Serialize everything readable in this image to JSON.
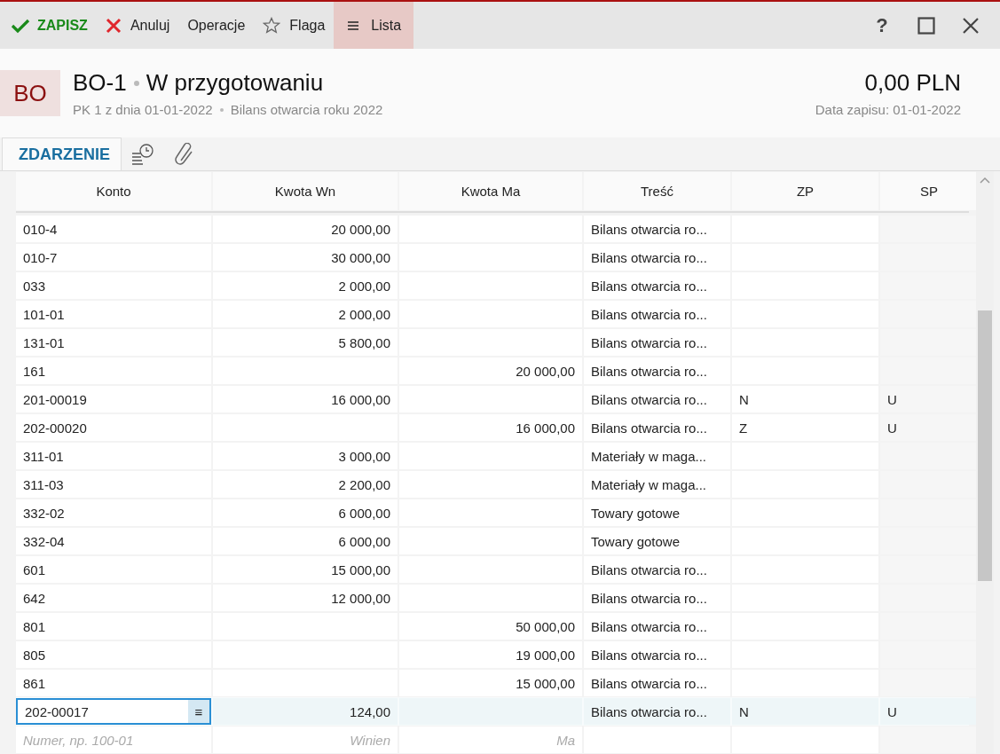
{
  "toolbar": {
    "buttons": [
      {
        "kind": "save",
        "label": "ZAPISZ",
        "selected": false
      },
      {
        "kind": "cancel",
        "label": "Anuluj",
        "selected": false
      },
      {
        "kind": "plain",
        "label": "Operacje",
        "selected": false
      },
      {
        "kind": "flag",
        "label": "Flaga",
        "selected": false
      },
      {
        "kind": "list",
        "label": "Lista",
        "selected": true
      }
    ],
    "help": "?"
  },
  "header": {
    "badge": "BO",
    "number": "BO-1",
    "status": "W przygotowaniu",
    "subtitle": "PK 1 z dnia 01-01-2022",
    "description": "Bilans otwarcia roku 2022",
    "amount": "0,00 PLN",
    "date": "Data zapisu: 01-01-2022"
  },
  "tabs": [
    {
      "kind": "text",
      "label": "ZDARZENIE",
      "selected": true
    },
    {
      "kind": "history",
      "selected": false
    },
    {
      "kind": "attachments",
      "selected": false
    }
  ],
  "table": {
    "columns": [
      "Konto",
      "Kwota Wn",
      "Kwota Ma",
      "Treść",
      "ZP",
      "SP"
    ],
    "rows": [
      {
        "konto": "010-4",
        "wn": "20 000,00",
        "ma": "",
        "tresc": "Bilans otwarcia ro...",
        "zp": "",
        "sp": "",
        "selected": false
      },
      {
        "konto": "010-7",
        "wn": "30 000,00",
        "ma": "",
        "tresc": "Bilans otwarcia ro...",
        "zp": "",
        "sp": "",
        "selected": false
      },
      {
        "konto": "033",
        "wn": "2 000,00",
        "ma": "",
        "tresc": "Bilans otwarcia ro...",
        "zp": "",
        "sp": "",
        "selected": false
      },
      {
        "konto": "101-01",
        "wn": "2 000,00",
        "ma": "",
        "tresc": "Bilans otwarcia ro...",
        "zp": "",
        "sp": "",
        "selected": false
      },
      {
        "konto": "131-01",
        "wn": "5 800,00",
        "ma": "",
        "tresc": "Bilans otwarcia ro...",
        "zp": "",
        "sp": "",
        "selected": false
      },
      {
        "konto": "161",
        "wn": "",
        "ma": "20 000,00",
        "tresc": "Bilans otwarcia ro...",
        "zp": "",
        "sp": "",
        "selected": false
      },
      {
        "konto": "201-00019",
        "wn": "16 000,00",
        "ma": "",
        "tresc": "Bilans otwarcia ro...",
        "zp": "N",
        "sp": "U",
        "selected": false
      },
      {
        "konto": "202-00020",
        "wn": "",
        "ma": "16 000,00",
        "tresc": "Bilans otwarcia ro...",
        "zp": "Z",
        "sp": "U",
        "selected": false
      },
      {
        "konto": "311-01",
        "wn": "3 000,00",
        "ma": "",
        "tresc": "Materiały w maga...",
        "zp": "",
        "sp": "",
        "selected": false
      },
      {
        "konto": "311-03",
        "wn": "2 200,00",
        "ma": "",
        "tresc": "Materiały w maga...",
        "zp": "",
        "sp": "",
        "selected": false
      },
      {
        "konto": "332-02",
        "wn": "6 000,00",
        "ma": "",
        "tresc": "Towary gotowe",
        "zp": "",
        "sp": "",
        "selected": false
      },
      {
        "konto": "332-04",
        "wn": "6 000,00",
        "ma": "",
        "tresc": "Towary gotowe",
        "zp": "",
        "sp": "",
        "selected": false
      },
      {
        "konto": "601",
        "wn": "15 000,00",
        "ma": "",
        "tresc": "Bilans otwarcia ro...",
        "zp": "",
        "sp": "",
        "selected": false
      },
      {
        "konto": "642",
        "wn": "12 000,00",
        "ma": "",
        "tresc": "Bilans otwarcia ro...",
        "zp": "",
        "sp": "",
        "selected": false
      },
      {
        "konto": "801",
        "wn": "",
        "ma": "50 000,00",
        "tresc": "Bilans otwarcia ro...",
        "zp": "",
        "sp": "",
        "selected": false
      },
      {
        "konto": "805",
        "wn": "",
        "ma": "19 000,00",
        "tresc": "Bilans otwarcia ro...",
        "zp": "",
        "sp": "",
        "selected": false
      },
      {
        "konto": "861",
        "wn": "",
        "ma": "15 000,00",
        "tresc": "Bilans otwarcia ro...",
        "zp": "",
        "sp": "",
        "selected": false
      },
      {
        "konto": "202-00017",
        "wn": "124,00",
        "ma": "",
        "tresc": "Bilans otwarcia ro...",
        "zp": "N",
        "sp": "U",
        "selected": true,
        "menu": "≡"
      }
    ],
    "new_row": {
      "konto_placeholder": "Numer, np. 100-01",
      "wn_placeholder": "Winien",
      "ma_placeholder": "Ma"
    }
  }
}
